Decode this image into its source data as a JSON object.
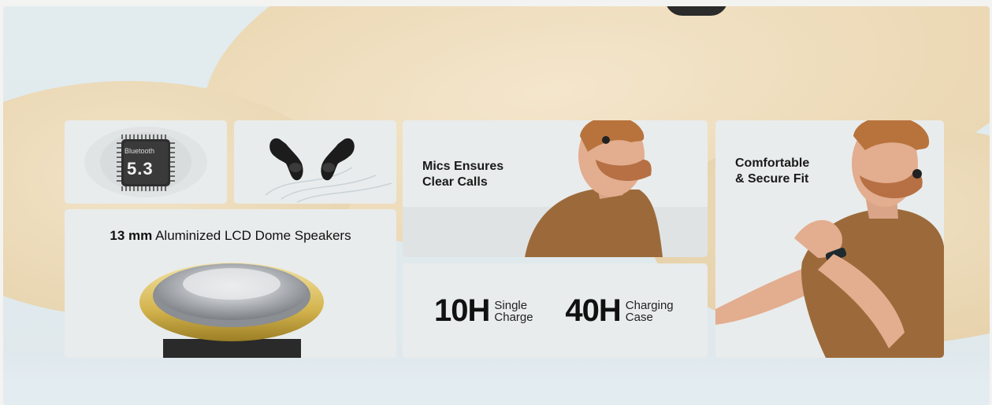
{
  "bluetooth_card": {
    "chip_label": "Bluetooth",
    "version": "5.3"
  },
  "earbuds_card": {
    "icon": "earbuds-icon"
  },
  "speaker_card": {
    "size": "13 mm",
    "label": "Aluminized LCD Dome Speakers"
  },
  "mic_card": {
    "line1": "Mics Ensures",
    "line2": "Clear Calls"
  },
  "battery_card": {
    "single_hours": "10H",
    "single_line1": "Single",
    "single_line2": "Charge",
    "case_hours": "40H",
    "case_line1": "Charging",
    "case_line2": "Case"
  },
  "fit_card": {
    "line1": "Comfortable",
    "line2": "& Secure Fit"
  },
  "colors": {
    "accent_gold": "#d9b95a",
    "card_bg": "#e9ecec",
    "background_cream": "#ecd9b6"
  }
}
